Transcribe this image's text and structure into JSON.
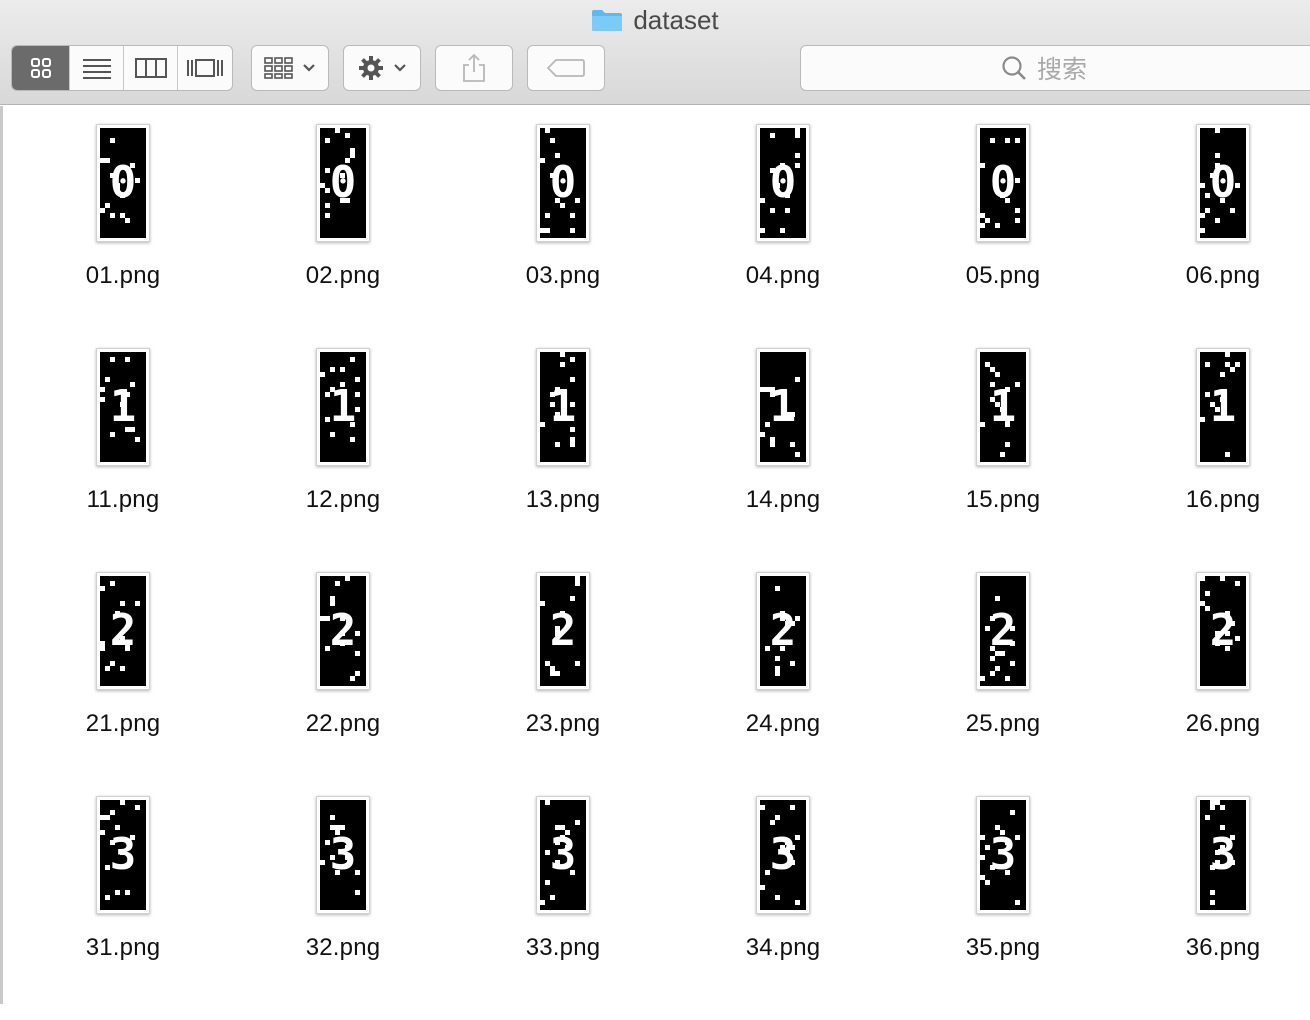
{
  "window": {
    "title": "dataset"
  },
  "toolbar": {
    "view_buttons": [
      "icon-view",
      "list-view",
      "column-view",
      "gallery-view"
    ],
    "active_view": "icon-view",
    "search_placeholder": "搜索"
  },
  "files": [
    {
      "name": "01.png",
      "digit": "0"
    },
    {
      "name": "02.png",
      "digit": "0"
    },
    {
      "name": "03.png",
      "digit": "0"
    },
    {
      "name": "04.png",
      "digit": "0"
    },
    {
      "name": "05.png",
      "digit": "0"
    },
    {
      "name": "06.png",
      "digit": "0"
    },
    {
      "name": "11.png",
      "digit": "1"
    },
    {
      "name": "12.png",
      "digit": "1"
    },
    {
      "name": "13.png",
      "digit": "1"
    },
    {
      "name": "14.png",
      "digit": "1"
    },
    {
      "name": "15.png",
      "digit": "1"
    },
    {
      "name": "16.png",
      "digit": "1"
    },
    {
      "name": "21.png",
      "digit": "2"
    },
    {
      "name": "22.png",
      "digit": "2"
    },
    {
      "name": "23.png",
      "digit": "2"
    },
    {
      "name": "24.png",
      "digit": "2"
    },
    {
      "name": "25.png",
      "digit": "2"
    },
    {
      "name": "26.png",
      "digit": "2"
    },
    {
      "name": "31.png",
      "digit": "3"
    },
    {
      "name": "32.png",
      "digit": "3"
    },
    {
      "name": "33.png",
      "digit": "3"
    },
    {
      "name": "34.png",
      "digit": "3"
    },
    {
      "name": "35.png",
      "digit": "3"
    },
    {
      "name": "36.png",
      "digit": "3"
    }
  ],
  "colors": {
    "folder": "#5fb8f0",
    "active_segment": "#6b6b6b"
  }
}
